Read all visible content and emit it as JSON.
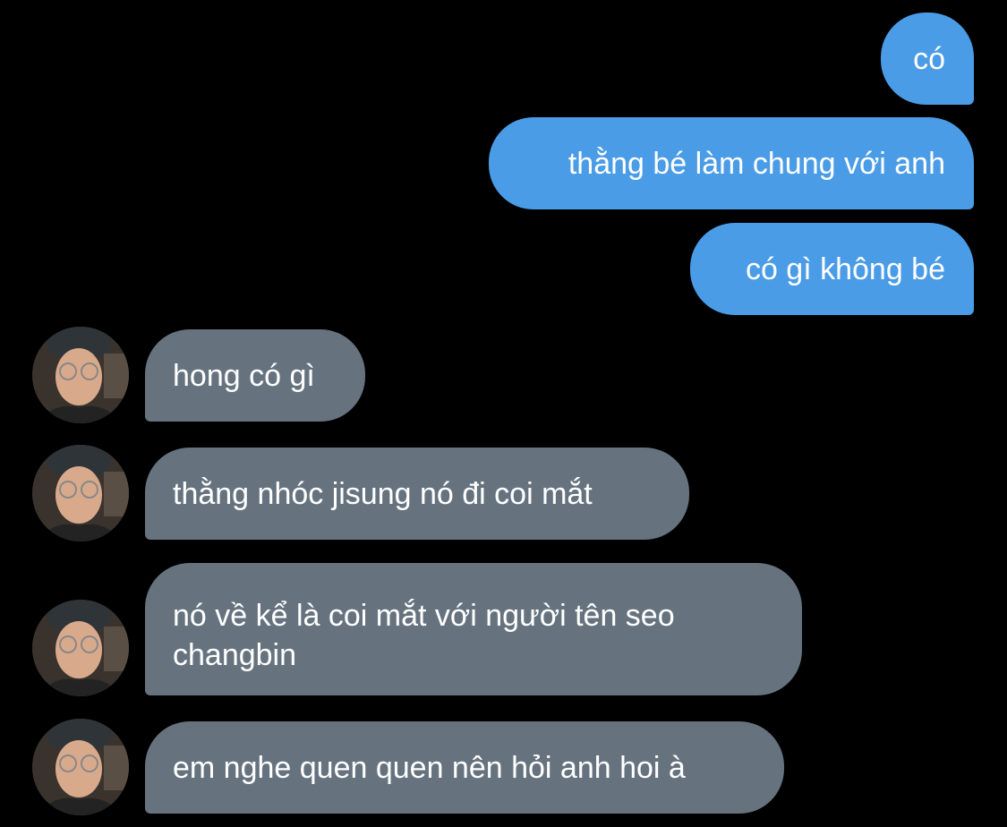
{
  "conversation": {
    "sent": [
      {
        "text": "có"
      },
      {
        "text": "thằng bé làm chung với anh"
      },
      {
        "text": "có gì không bé"
      }
    ],
    "received": [
      {
        "text": "hong có gì"
      },
      {
        "text": "thằng nhóc jisung nó đi coi mắt"
      },
      {
        "text": "nó về kể là coi mắt với người tên seo changbin"
      },
      {
        "text": "em nghe quen quen nên hỏi anh hoi à"
      }
    ]
  },
  "colors": {
    "background": "#000000",
    "sent_bubble": "#4a9ce6",
    "received_bubble": "#66737f",
    "text": "#ffffff"
  },
  "icons": {
    "avatar": "contact-avatar-photo"
  }
}
